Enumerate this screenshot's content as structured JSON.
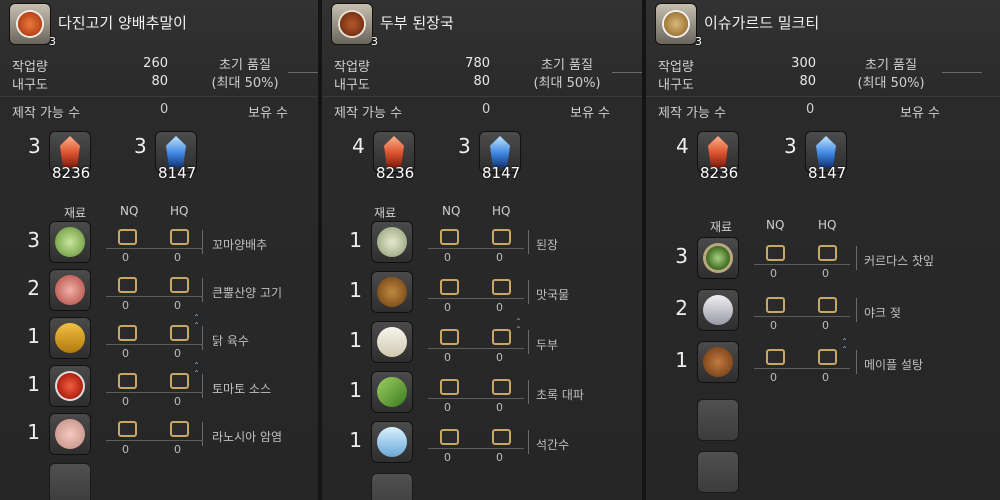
{
  "labels": {
    "progress": "작업량",
    "durability": "내구도",
    "initial_quality": "초기 품질",
    "max_note": "(최대 50%)",
    "craftable": "제작 가능 수",
    "owned": "보유 수",
    "materials": "재료",
    "nq": "NQ",
    "hq": "HQ",
    "zero": "0"
  },
  "recipes": [
    {
      "title": "다진고기 양배추말이",
      "icon_count": "3",
      "progress": "260",
      "durability": "80",
      "craftable": "0",
      "crystals": [
        {
          "qty": "3",
          "count": "8236",
          "type": "fire"
        },
        {
          "qty": "3",
          "count": "8147",
          "type": "water"
        }
      ],
      "materials": [
        {
          "qty": "3",
          "name": "꼬마양배추",
          "icon": "cabbage-icon",
          "hq_up": false
        },
        {
          "qty": "2",
          "name": "큰뿔산양 고기",
          "icon": "meat-icon",
          "hq_up": false
        },
        {
          "qty": "1",
          "name": "닭 육수",
          "icon": "broth-jar-icon",
          "hq_up": true
        },
        {
          "qty": "1",
          "name": "토마토 소스",
          "icon": "tomato-sauce-icon",
          "hq_up": true
        },
        {
          "qty": "1",
          "name": "라노시아 암염",
          "icon": "rock-salt-icon",
          "hq_up": false
        }
      ]
    },
    {
      "title": "두부 된장국",
      "icon_count": "3",
      "progress": "780",
      "durability": "80",
      "craftable": "0",
      "crystals": [
        {
          "qty": "4",
          "count": "8236",
          "type": "fire"
        },
        {
          "qty": "3",
          "count": "8147",
          "type": "water"
        }
      ],
      "materials": [
        {
          "qty": "1",
          "name": "된장",
          "icon": "miso-jar-icon",
          "hq_up": false
        },
        {
          "qty": "1",
          "name": "맛국물",
          "icon": "stock-pot-icon",
          "hq_up": false
        },
        {
          "qty": "1",
          "name": "두부",
          "icon": "tofu-icon",
          "hq_up": true
        },
        {
          "qty": "1",
          "name": "초록 대파",
          "icon": "green-onion-icon",
          "hq_up": false
        },
        {
          "qty": "1",
          "name": "석간수",
          "icon": "water-bottle-icon",
          "hq_up": false
        }
      ]
    },
    {
      "title": "이슈가르드 밀크티",
      "icon_count": "3",
      "progress": "300",
      "durability": "80",
      "craftable": "0",
      "crystals": [
        {
          "qty": "4",
          "count": "8236",
          "type": "fire"
        },
        {
          "qty": "3",
          "count": "8147",
          "type": "water"
        }
      ],
      "materials": [
        {
          "qty": "3",
          "name": "커르다스 찻잎",
          "icon": "tea-leaves-icon",
          "hq_up": false
        },
        {
          "qty": "2",
          "name": "야크 젖",
          "icon": "milk-can-icon",
          "hq_up": false
        },
        {
          "qty": "1",
          "name": "메이플 설탕",
          "icon": "sugar-pot-icon",
          "hq_up": true
        }
      ]
    }
  ],
  "colors": {
    "checkbox": "#c9a867",
    "hq_arrow": "#6fc3e8",
    "fire": "#d9502c",
    "water": "#3d86e0"
  }
}
